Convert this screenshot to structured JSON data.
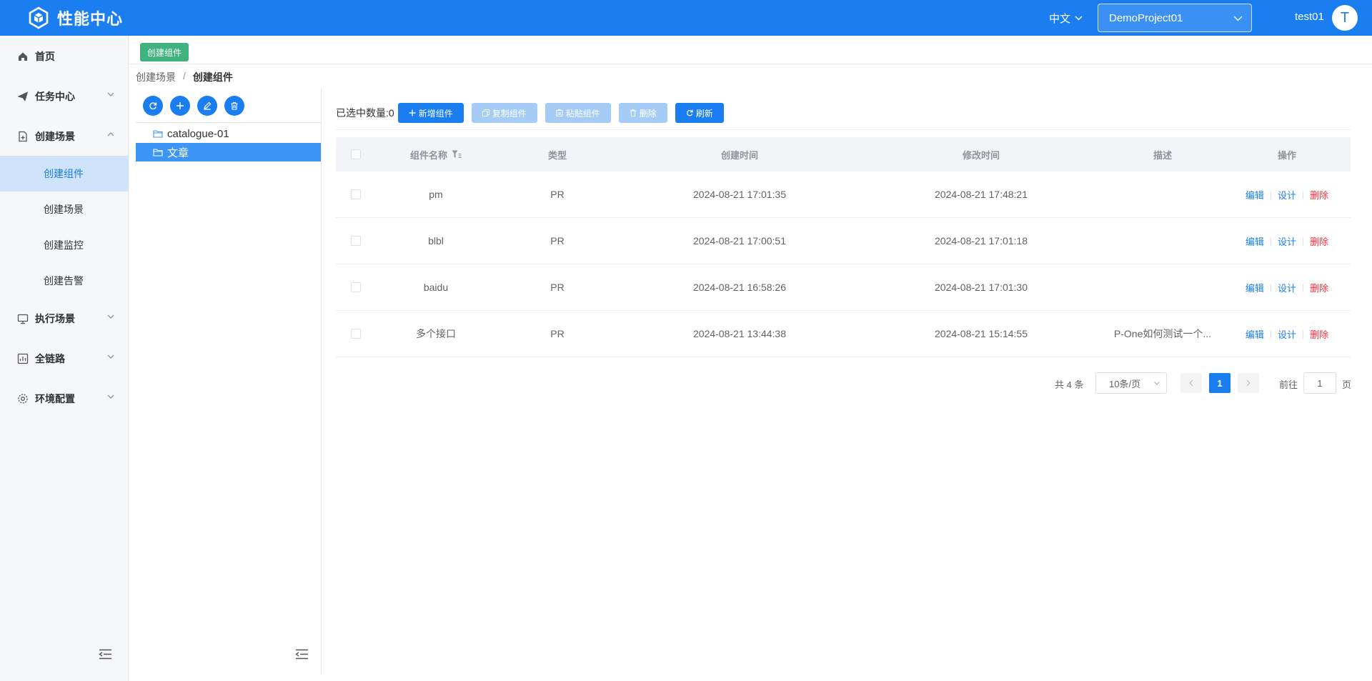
{
  "app": {
    "title": "性能中心",
    "lang": "中文",
    "project": "DemoProject01",
    "user": "test01",
    "avatar_letter": "T"
  },
  "nav": {
    "home": "首页",
    "task_center": "任务中心",
    "create_scene": "创建场景",
    "sub": {
      "create_component": "创建组件",
      "create_scenario": "创建场景",
      "create_monitor": "创建监控",
      "create_alert": "创建告警"
    },
    "exec_scene": "执行场景",
    "full_link": "全链路",
    "env_config": "环境配置"
  },
  "tabs": {
    "active": "创建组件"
  },
  "breadcrumb": {
    "parent": "创建场景",
    "sep": "/",
    "current": "创建组件"
  },
  "tree": {
    "nodes": [
      "catalogue-01",
      "文章"
    ],
    "selected_index": 1
  },
  "toolbar": {
    "selected_label": "已选中数量:0",
    "add": "新增组件",
    "copy": "复制组件",
    "paste": "粘贴组件",
    "delete": "删除",
    "refresh": "刷新"
  },
  "table": {
    "headers": {
      "name": "组件名称",
      "type": "类型",
      "created": "创建时间",
      "modified": "修改时间",
      "desc": "描述",
      "ops": "操作"
    },
    "ops": {
      "edit": "编辑",
      "design": "设计",
      "delete": "删除",
      "sep": "|"
    },
    "rows": [
      {
        "name": "pm",
        "type": "PR",
        "created": "2024-08-21 17:01:35",
        "modified": "2024-08-21 17:48:21",
        "desc": ""
      },
      {
        "name": "blbl",
        "type": "PR",
        "created": "2024-08-21 17:00:51",
        "modified": "2024-08-21 17:01:18",
        "desc": ""
      },
      {
        "name": "baidu",
        "type": "PR",
        "created": "2024-08-21 16:58:26",
        "modified": "2024-08-21 17:01:30",
        "desc": ""
      },
      {
        "name": "多个接口",
        "type": "PR",
        "created": "2024-08-21 13:44:38",
        "modified": "2024-08-21 15:14:55",
        "desc": "P-One如何测试一个..."
      }
    ]
  },
  "pagination": {
    "total": "共 4 条",
    "page_size": "10条/页",
    "current": "1",
    "goto_label": "前往",
    "goto_value": "1",
    "unit": "页"
  },
  "colors": {
    "brand": "#1a7ef0",
    "tag_green": "#3fb27f",
    "danger": "#f0313c",
    "nav_active_bg": "#cfe3fb"
  }
}
